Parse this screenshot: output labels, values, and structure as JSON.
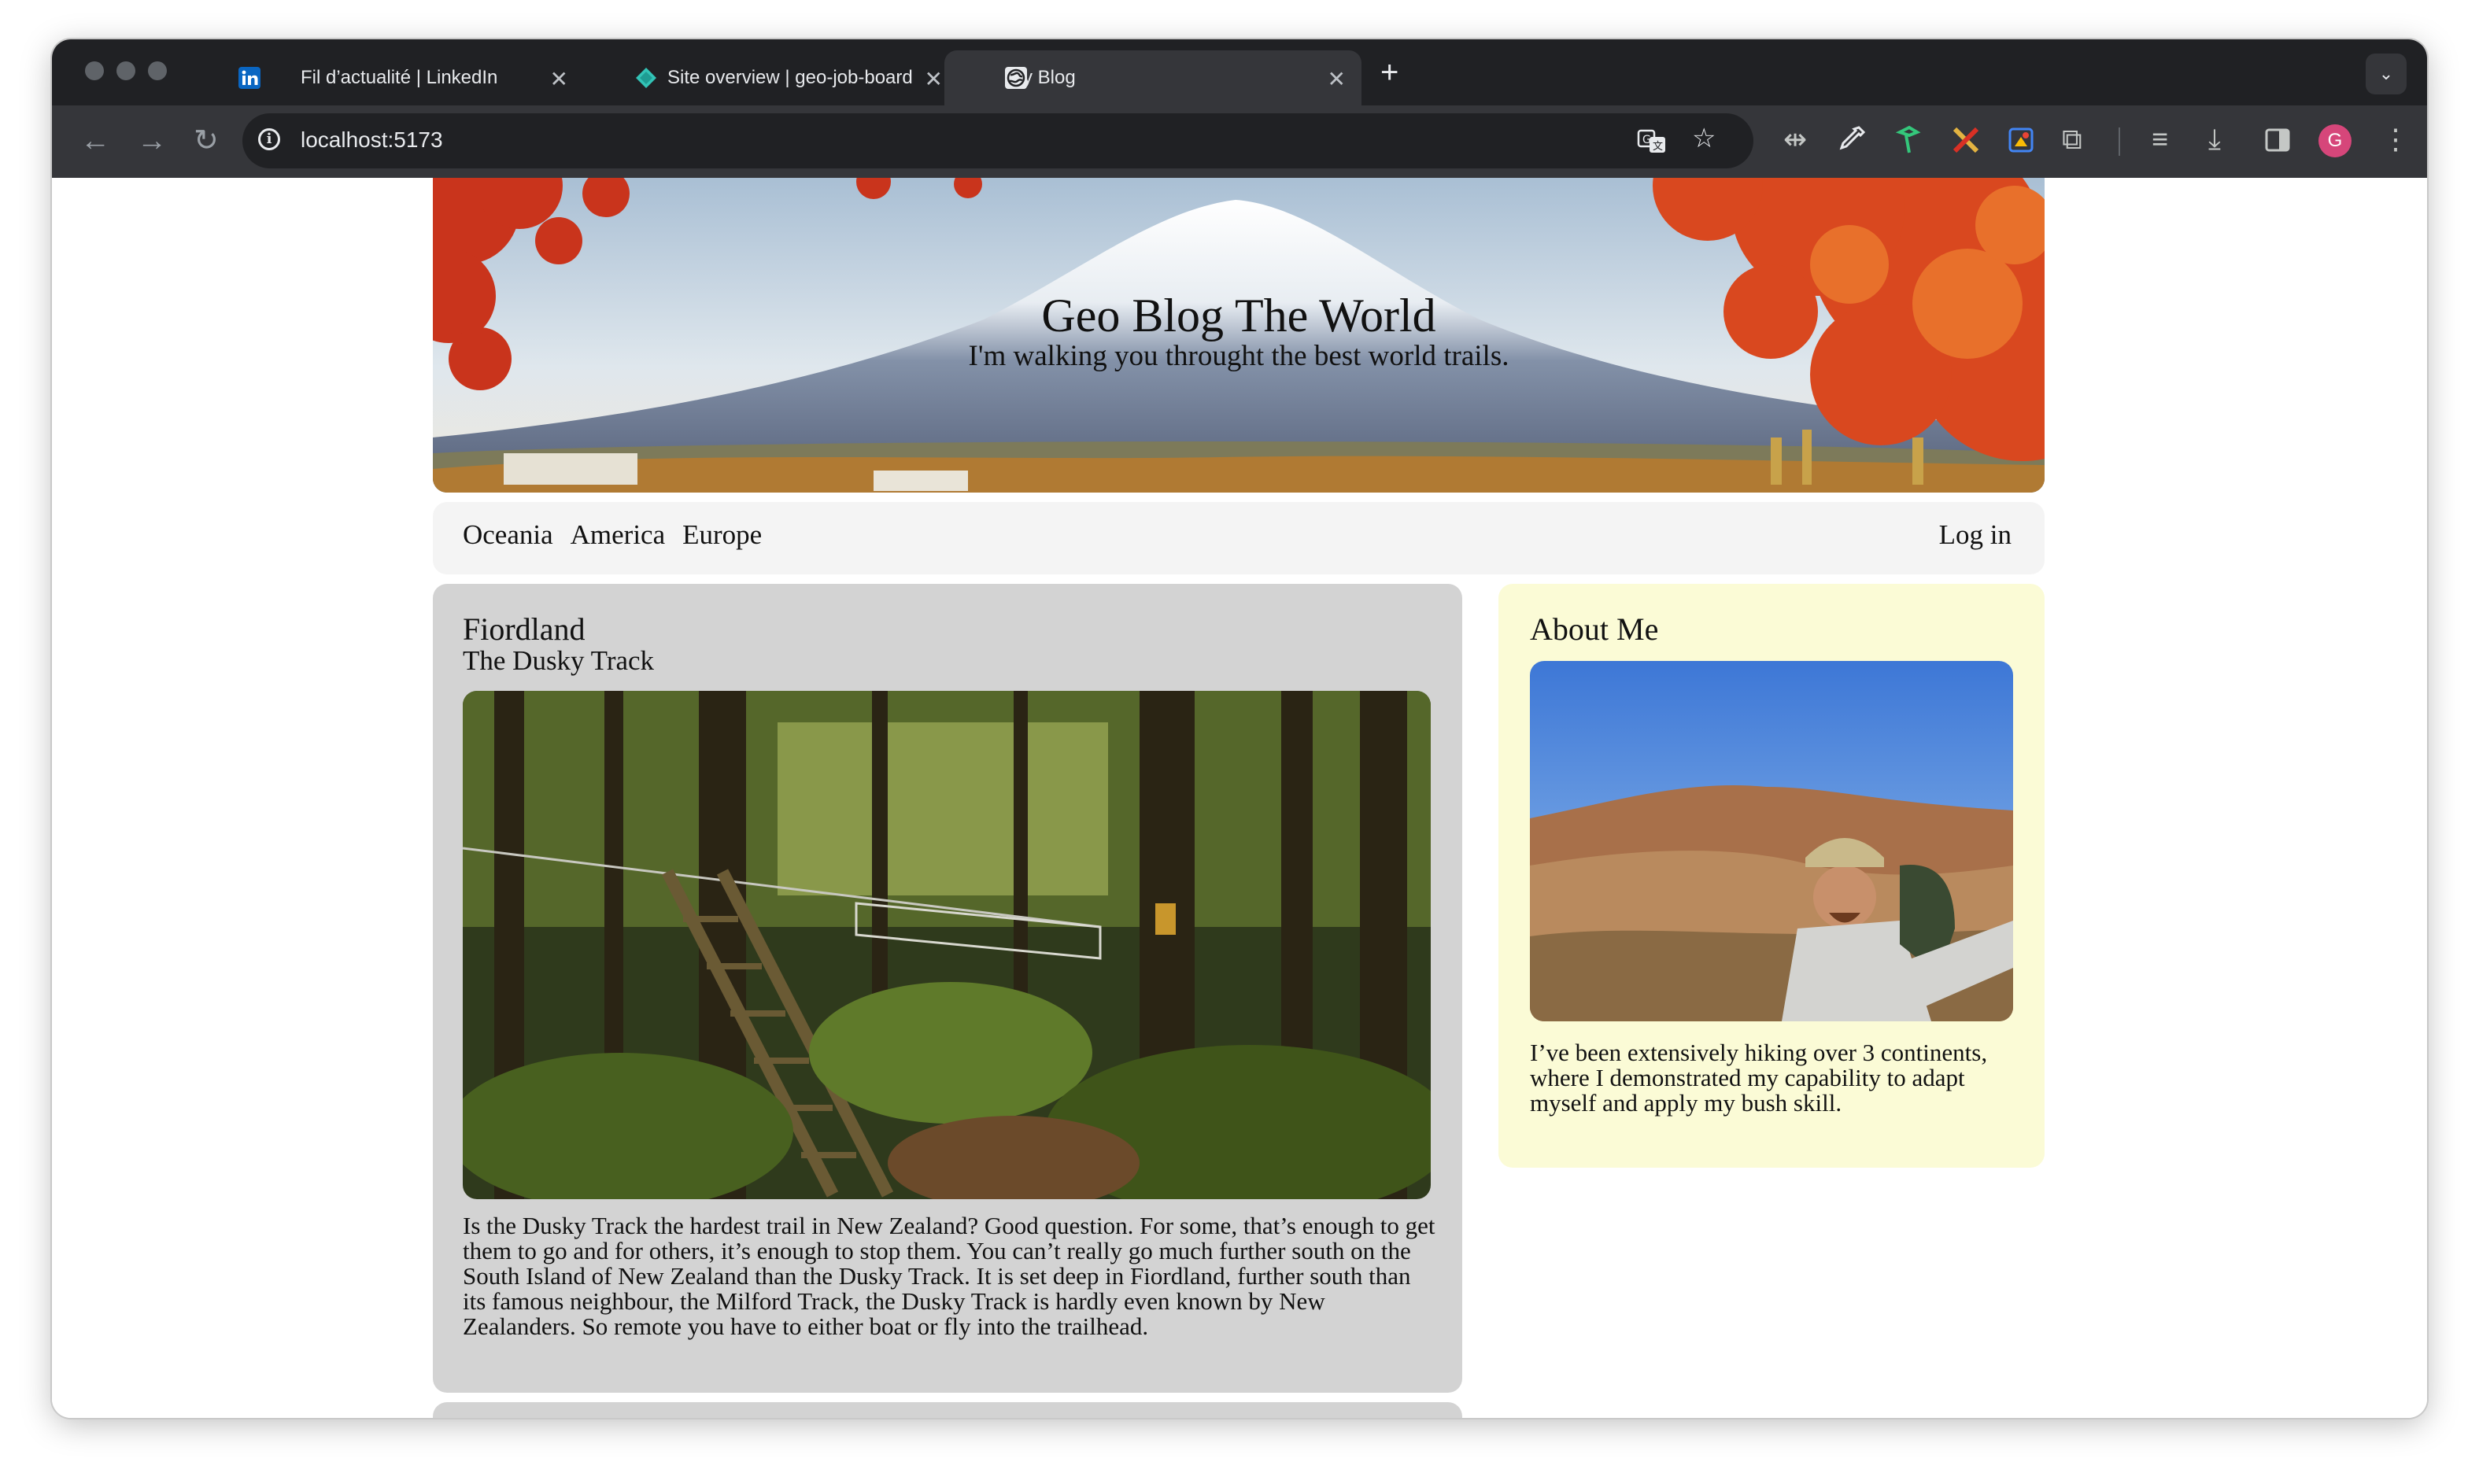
{
  "browser": {
    "tabs": [
      {
        "title": "Fil d’actualité | LinkedIn",
        "icon": "linkedin-icon"
      },
      {
        "title": "Site overview | geo-job-board",
        "icon": "netlify-icon"
      },
      {
        "title": "My Blog",
        "icon": "globe-icon"
      }
    ],
    "url": "localhost:5173",
    "profile_initial": "G",
    "accent": "#35363a"
  },
  "blog": {
    "title": "Geo Blog The World",
    "tagline": "I'm walking you throught the best world trails.",
    "nav": [
      "Oceania",
      "America",
      "Europe"
    ],
    "login": "Log in",
    "post": {
      "title": "Fiordland",
      "subtitle": "The Dusky Track",
      "body": "Is the Dusky Track the hardest trail in New Zealand? Good question. For some, that’s enough to get them to go and for others, it’s enough to stop them. You can’t really go much further south on the South Island of New Zealand than the Dusky Track. It is set deep in Fiordland, further south than its famous neighbour, the Milford Track, the Dusky Track is hardly even known by New Zealanders. So remote you have to either boat or fly into the trailhead."
    },
    "about": {
      "title": "About Me",
      "body": "I’ve been extensively hiking over 3 continents, where I demonstrated my capability to adapt myself and apply my bush skill."
    }
  }
}
